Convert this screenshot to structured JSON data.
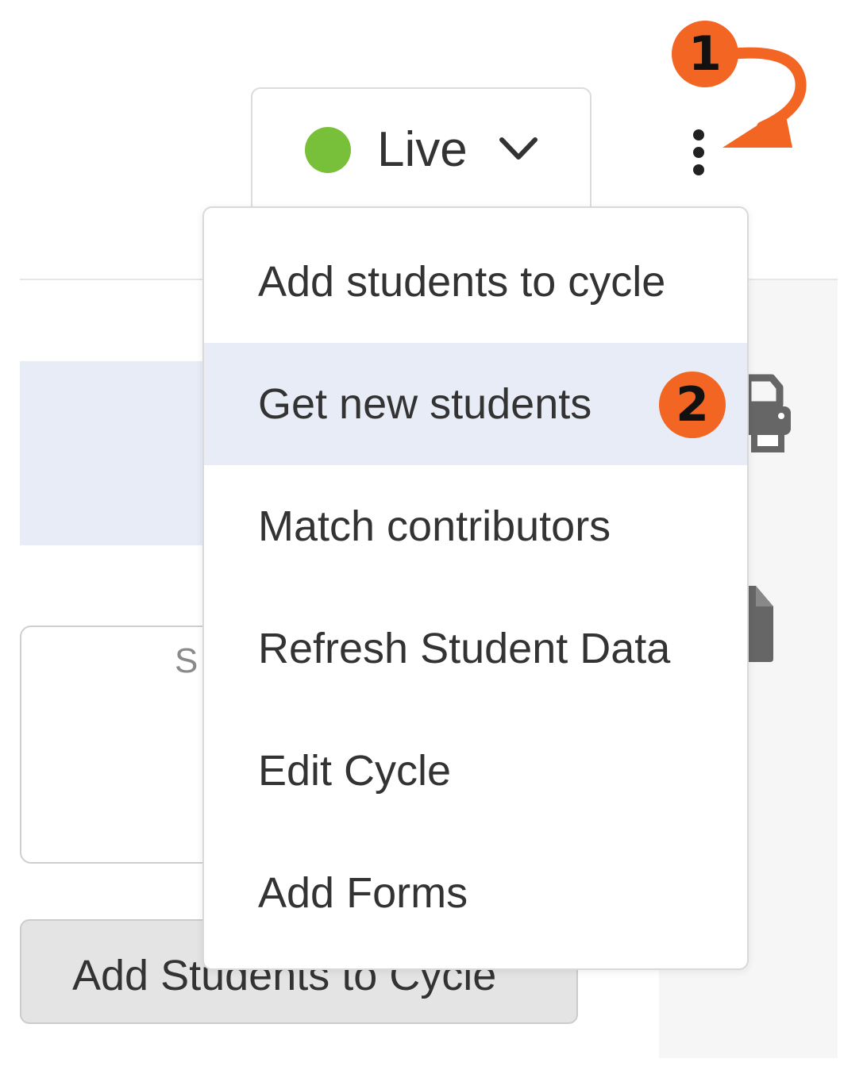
{
  "status": {
    "label": "Live",
    "dot_color": "#78c03a",
    "chevron_icon": "chevron-down-icon"
  },
  "more_menu": {
    "icon": "kebab-vertical-icon"
  },
  "context_menu": {
    "items": [
      {
        "label": "Add students to cycle",
        "highlighted": false
      },
      {
        "label": "Get new students",
        "highlighted": true
      },
      {
        "label": "Match contributors",
        "highlighted": false
      },
      {
        "label": "Refresh Student Data",
        "highlighted": false
      },
      {
        "label": "Edit Cycle",
        "highlighted": false
      },
      {
        "label": "Add Forms",
        "highlighted": false
      }
    ]
  },
  "background": {
    "search_placeholder": "S",
    "add_students_button": "Add Students to Cycle"
  },
  "annotations": {
    "step1": "1",
    "step2": "2",
    "badge_color": "#f26522"
  },
  "side_icons": [
    "print-icon",
    "file-icon"
  ]
}
